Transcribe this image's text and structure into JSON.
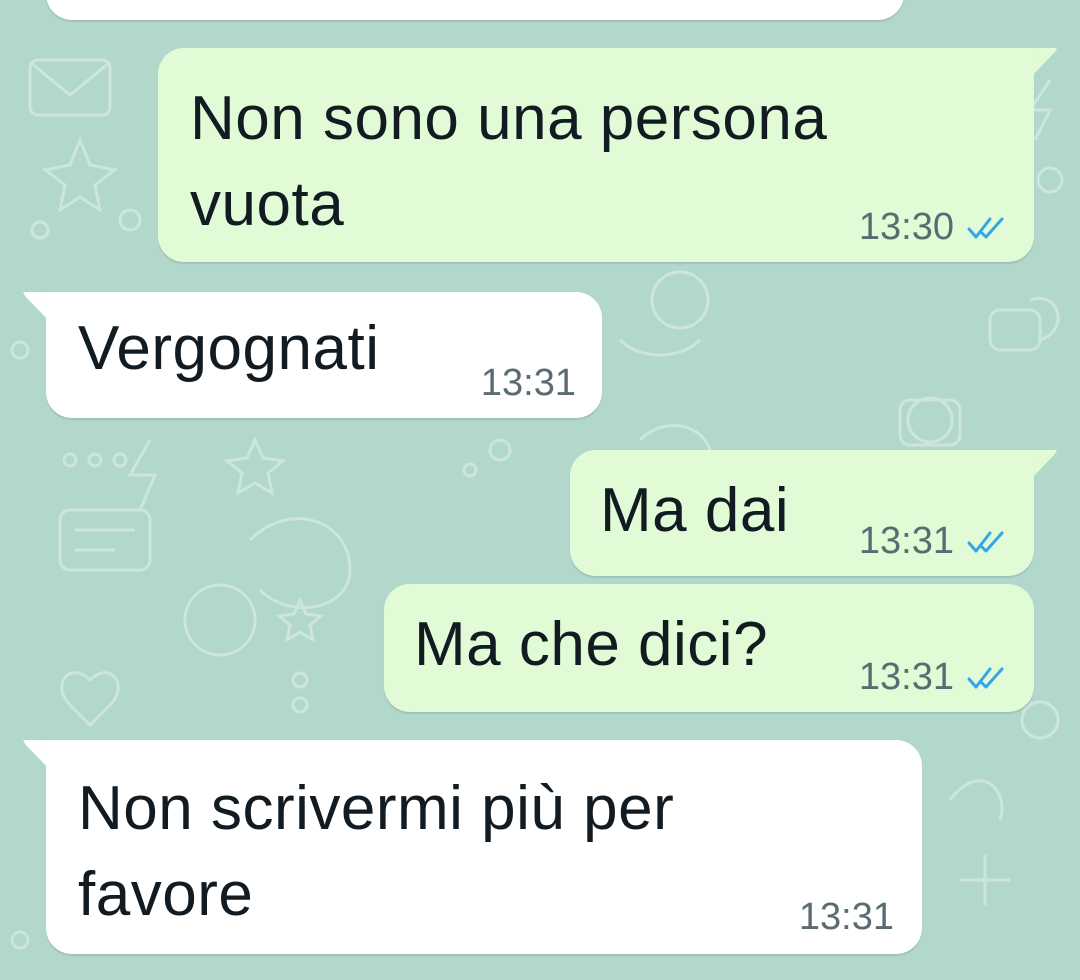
{
  "colors": {
    "wallpaper": "#b2d8cc",
    "outgoing_bubble": "#e2fbd7",
    "incoming_bubble": "#ffffff",
    "read_ticks": "#34a6e8",
    "timestamp": "#5b6b72"
  },
  "messages": [
    {
      "direction": "outgoing",
      "text": "Non sono una persona\nvuota",
      "time": "13:30",
      "status": "read",
      "status_icon": "double-check-icon"
    },
    {
      "direction": "incoming",
      "text": "Vergognati",
      "time": "13:31"
    },
    {
      "direction": "outgoing",
      "text": "Ma dai",
      "time": "13:31",
      "status": "read",
      "status_icon": "double-check-icon"
    },
    {
      "direction": "outgoing",
      "text": "Ma che dici?",
      "time": "13:31",
      "status": "read",
      "status_icon": "double-check-icon"
    },
    {
      "direction": "incoming",
      "text": "Non scrivermi più per\nfavore",
      "time": "13:31"
    }
  ]
}
